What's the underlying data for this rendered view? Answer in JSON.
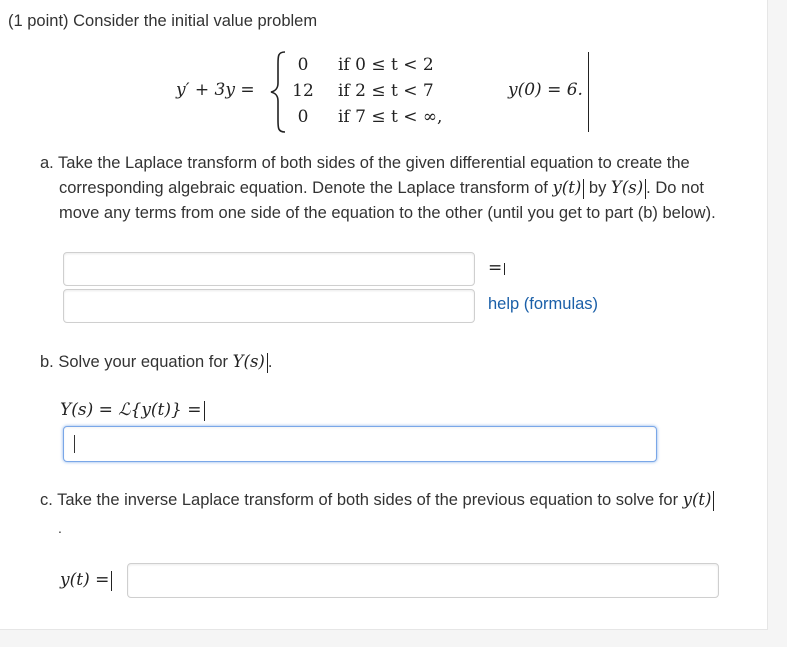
{
  "header": {
    "points": "(1 point)",
    "intro": " Consider the initial value problem"
  },
  "equation": {
    "lhs": "y′ + 3y =",
    "cases": [
      {
        "value": "0",
        "condition": "if 0 ≤ t < 2"
      },
      {
        "value": "12",
        "condition": "if 2 ≤ t < 7"
      },
      {
        "value": "0",
        "condition": "if 7 ≤ t < ∞,"
      }
    ],
    "initial": "y(0) = 6."
  },
  "part_a": {
    "line1": "a. Take the Laplace transform of both sides of the given differential equation to create the",
    "line2_pre": "corresponding algebraic equation. Denote the Laplace transform of ",
    "line2_math1": "y(t)",
    "line2_mid": " by ",
    "line2_math2": "Y(s)",
    "line2_post": ". Do not",
    "line3": "move any terms from one side of the equation to the other (until you get to part (b) below).",
    "equals_sign": "=",
    "help_link": "help (formulas)",
    "input_left_value": "",
    "input_right_value": ""
  },
  "part_b": {
    "prompt_pre": "b. Solve your equation for ",
    "prompt_math": "Y(s)",
    "prompt_post": ".",
    "label": "Y(s) = ℒ{y(t)} =",
    "input_value": ""
  },
  "part_c": {
    "prompt_pre": "c. Take the inverse Laplace transform of both sides of the previous equation to solve for ",
    "prompt_math": "y(t)",
    "dot": ".",
    "label": "y(t) =",
    "input_value": ""
  }
}
